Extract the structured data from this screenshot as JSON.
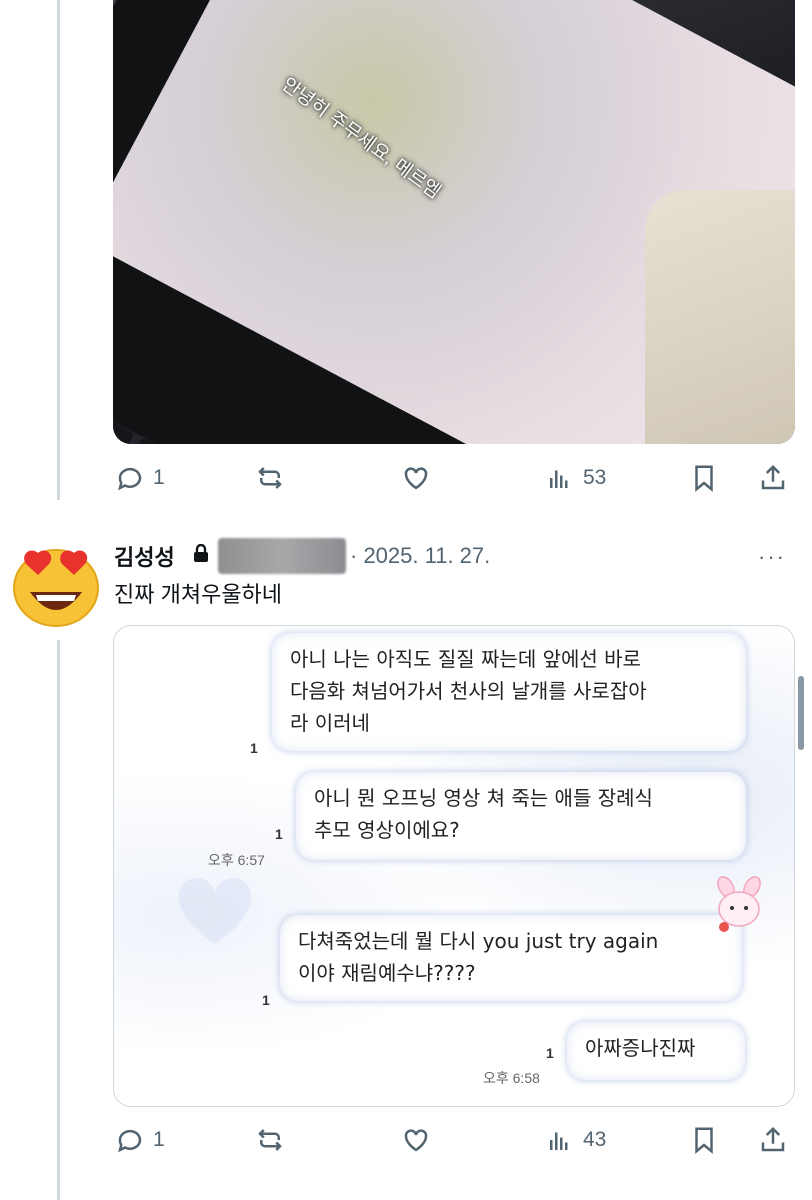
{
  "post1": {
    "media_caption": "안녕히 주무세요, 메르엠",
    "actions": {
      "replies": "1",
      "views": "53"
    }
  },
  "post2": {
    "name": "김성성",
    "date": "· 2025. 11. 27.",
    "more": "···",
    "text": "진짜 개쳐우울하네",
    "chat": {
      "messages": [
        {
          "text_line1": "아니 나는 아직도 질질 짜는데 앞에선 바로",
          "text_line2": "다음화 쳐넘어가서 천사의 날개를 사로잡아",
          "text_line3": "라 이러네",
          "read": "1"
        },
        {
          "text_line1": "아니 뭔 오프닝 영상 쳐 죽는 애들 장례식",
          "text_line2": "추모 영상이에요?",
          "read": "1",
          "time": "오후 6:57"
        },
        {
          "text_line1": "다쳐죽었는데 뭘 다시 you just try again",
          "text_line2": "이야 재림예수냐????",
          "read": "1"
        },
        {
          "text_line1": "아짜증나진짜",
          "read": "1",
          "time": "오후 6:58"
        }
      ]
    },
    "actions": {
      "replies": "1",
      "views": "43"
    }
  },
  "colors": {
    "icon": "#536471",
    "text": "#0f1419",
    "border": "#cfd9de",
    "bubble_glow": "#b4c4e4"
  },
  "icons": [
    "reply-icon",
    "retweet-icon",
    "like-icon",
    "views-icon",
    "bookmark-icon",
    "share-icon",
    "lock-icon",
    "more-icon"
  ]
}
